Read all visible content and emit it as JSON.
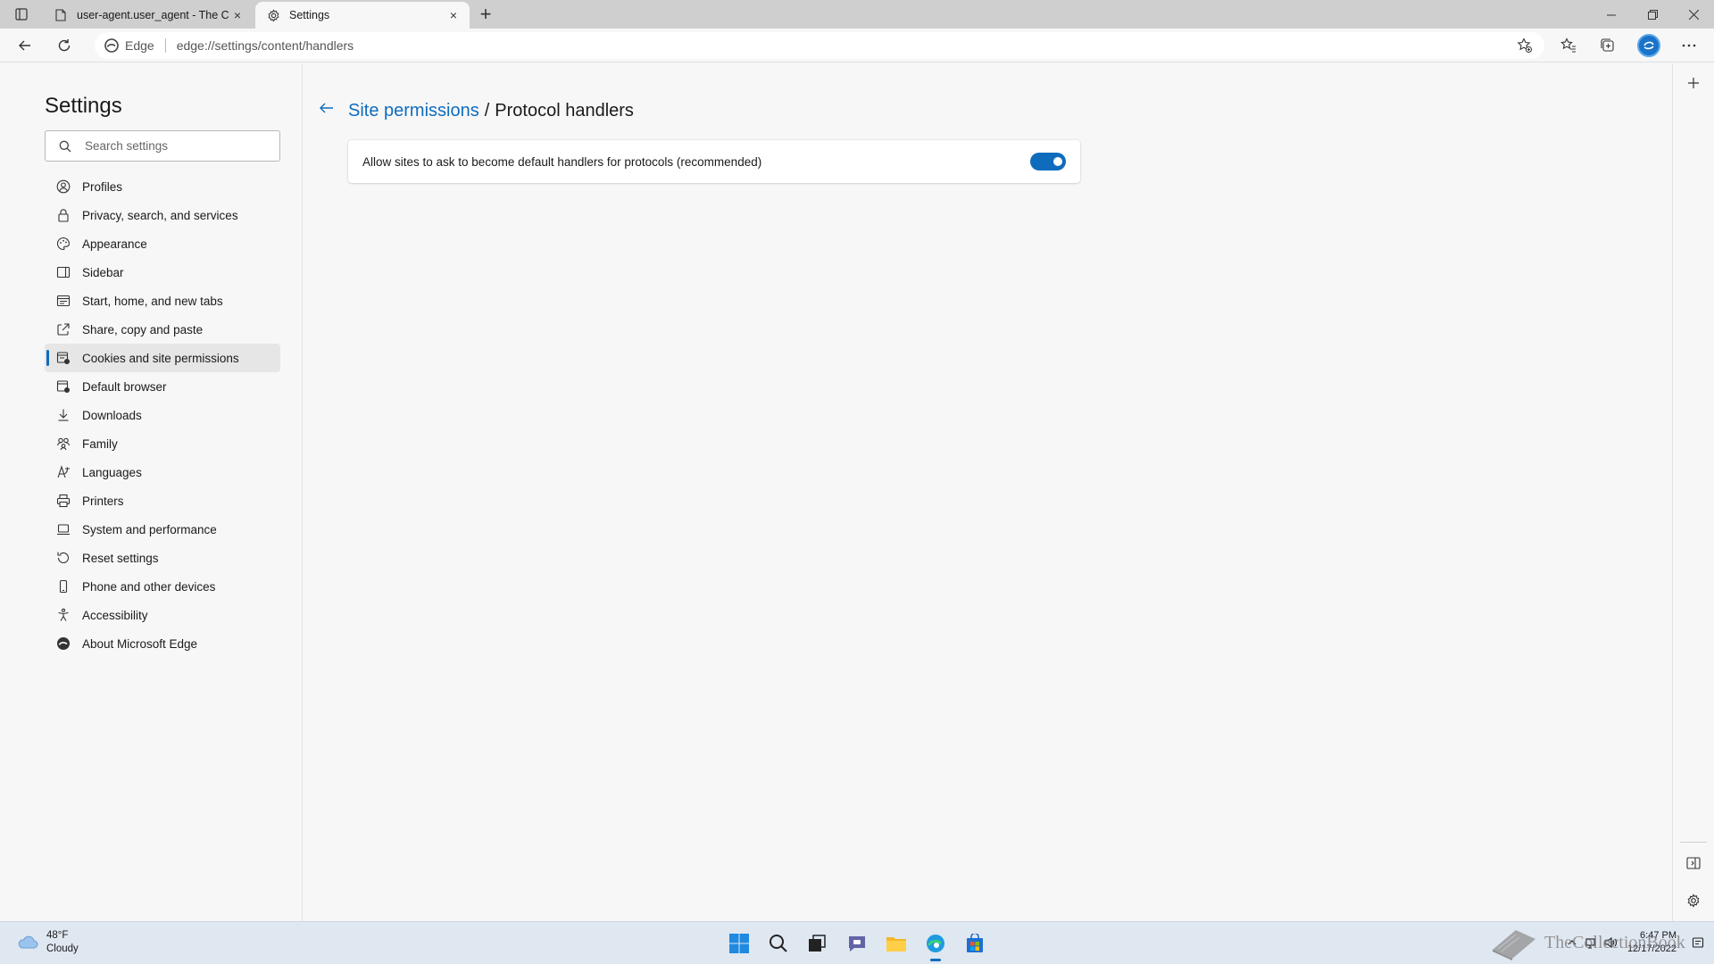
{
  "browser": {
    "tabs": [
      {
        "title": "user-agent.user_agent - The Coll",
        "close": "×"
      },
      {
        "title": "Settings",
        "close": "×"
      }
    ],
    "new_tab": "+",
    "address": {
      "site_label": "Edge",
      "url": "edge://settings/content/handlers"
    }
  },
  "sidebar": {
    "title": "Settings",
    "search_placeholder": "Search settings",
    "items": [
      {
        "label": "Profiles",
        "icon": "profile-icon"
      },
      {
        "label": "Privacy, search, and services",
        "icon": "lock-icon"
      },
      {
        "label": "Appearance",
        "icon": "appearance-icon"
      },
      {
        "label": "Sidebar",
        "icon": "sidebar-icon"
      },
      {
        "label": "Start, home, and new tabs",
        "icon": "home-tabs-icon"
      },
      {
        "label": "Share, copy and paste",
        "icon": "share-icon"
      },
      {
        "label": "Cookies and site permissions",
        "icon": "cookies-icon",
        "selected": true
      },
      {
        "label": "Default browser",
        "icon": "default-browser-icon"
      },
      {
        "label": "Downloads",
        "icon": "download-icon"
      },
      {
        "label": "Family",
        "icon": "family-icon"
      },
      {
        "label": "Languages",
        "icon": "languages-icon"
      },
      {
        "label": "Printers",
        "icon": "printer-icon"
      },
      {
        "label": "System and performance",
        "icon": "system-icon"
      },
      {
        "label": "Reset settings",
        "icon": "reset-icon"
      },
      {
        "label": "Phone and other devices",
        "icon": "phone-icon"
      },
      {
        "label": "Accessibility",
        "icon": "accessibility-icon"
      },
      {
        "label": "About Microsoft Edge",
        "icon": "edge-icon"
      }
    ]
  },
  "main": {
    "breadcrumb_parent": "Site permissions",
    "breadcrumb_sep": "/",
    "breadcrumb_current": "Protocol handlers",
    "setting_label": "Allow sites to ask to become default handlers for protocols (recommended)",
    "toggle_on": true
  },
  "taskbar": {
    "weather_temp": "48°F",
    "weather_desc": "Cloudy",
    "time": "6:47 PM",
    "date": "12/17/2022",
    "watermark": "TheCollectionBook"
  },
  "colors": {
    "accent": "#0f6cbd"
  }
}
